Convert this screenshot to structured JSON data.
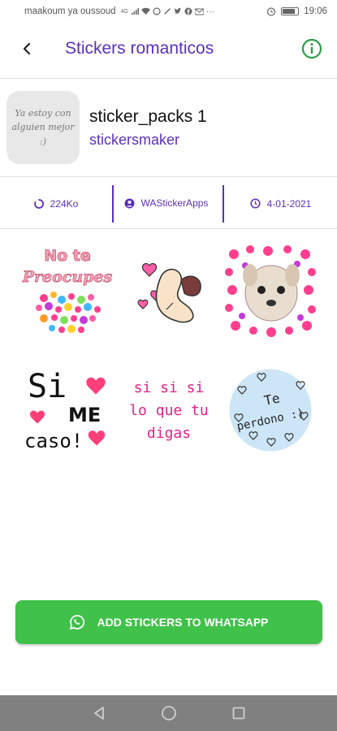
{
  "status_bar": {
    "carrier": "maakoum ya oussoud",
    "network": "4G",
    "time": "19:06",
    "icons": [
      "signal-icon",
      "wifi-icon",
      "whatsapp-icon",
      "twitter-icon",
      "facebook-icon",
      "gmail-icon",
      "more-icon",
      "alarm-icon",
      "battery-icon"
    ]
  },
  "app_bar": {
    "title": "Stickers romanticos"
  },
  "pack": {
    "tray_text": "Ya estoy con alguien mejor :)",
    "name": "sticker_packs 1",
    "publisher": "stickersmaker"
  },
  "meta": {
    "size": "224Ko",
    "publisher": "WAStickerApps",
    "date": "4-01-2021"
  },
  "stickers": [
    {
      "name": "sticker-no-te-preocupes",
      "text": "No te Preocupes"
    },
    {
      "name": "sticker-heart-hand",
      "text": ""
    },
    {
      "name": "sticker-dog-hearts",
      "text": ""
    },
    {
      "name": "sticker-si-me-caso",
      "text": "Si ME caso!"
    },
    {
      "name": "sticker-si-si-si",
      "text": "si si si lo que tu digas"
    },
    {
      "name": "sticker-te-perdono",
      "text": "Te perdono :)"
    }
  ],
  "sticker_texts": {
    "no_te": "No te",
    "preocupes": "Preocupes",
    "si": "Si",
    "me": "ME",
    "caso": "caso!",
    "si_si_si": "si si si",
    "lo_que_tu": "lo que tu",
    "digas": "digas",
    "te": "Te",
    "perdono": "perdono :)"
  },
  "add_button": {
    "label": "ADD STICKERS TO WHATSAPP"
  },
  "colors": {
    "accent": "#5b2fbf",
    "button": "#3fc14a",
    "info": "#2e9c47",
    "nav_bar": "#808080"
  }
}
